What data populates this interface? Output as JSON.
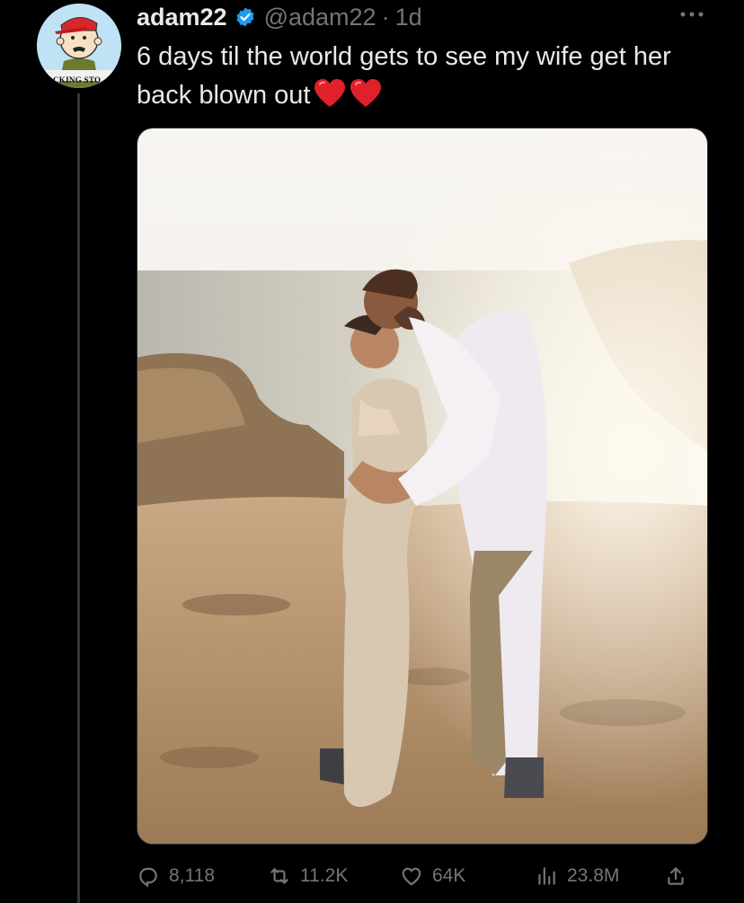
{
  "tweet": {
    "avatar_text": "CKING STO",
    "display_name": "adam22",
    "handle": "@adam22",
    "separator": "·",
    "time": "1d",
    "text": "6 days til the world gets to see my wife get her back blown out",
    "emojis": [
      "red-heart",
      "red-heart"
    ],
    "verified": true
  },
  "actions": {
    "replies": "8,118",
    "reposts": "11.2K",
    "likes": "64K",
    "views": "23.8M"
  },
  "colors": {
    "background": "#000000",
    "text": "#e7e9ea",
    "muted": "#71767b",
    "verified": "#1d9bf0",
    "heart": "#e0202b"
  }
}
